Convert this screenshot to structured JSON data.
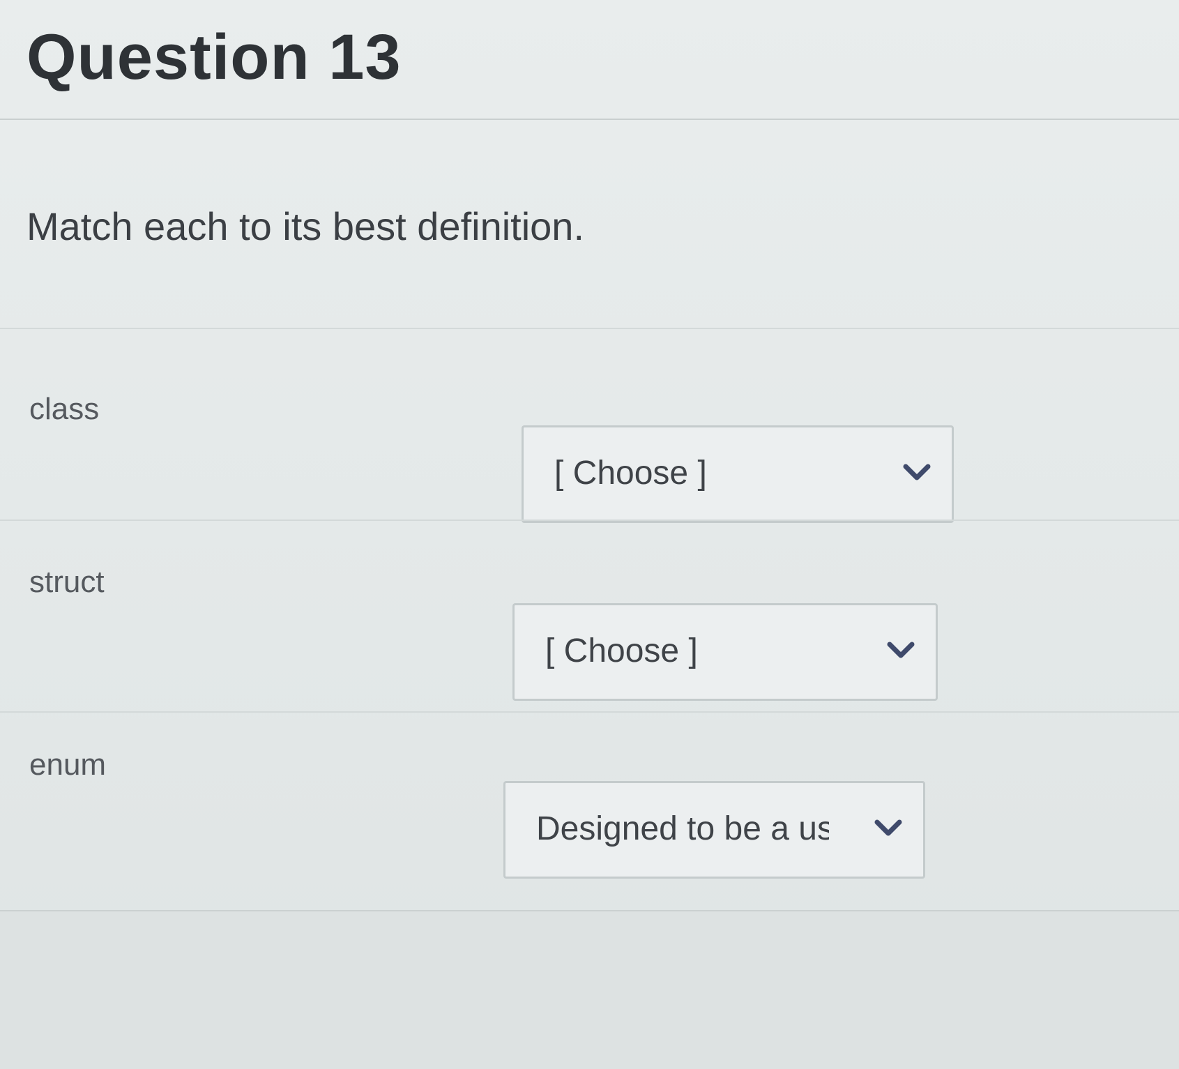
{
  "question": {
    "title": "Question 13",
    "prompt": "Match each to its best definition."
  },
  "matches": [
    {
      "term": "class",
      "selected": "[ Choose ]"
    },
    {
      "term": "struct",
      "selected": "[ Choose ]"
    },
    {
      "term": "enum",
      "selected": "Designed to be a us"
    }
  ],
  "icons": {
    "dropdown": "chevron-down-icon"
  },
  "colors": {
    "chevron": "#3f4a6b",
    "text": "#3b3f44",
    "background": "#e6eaea"
  }
}
